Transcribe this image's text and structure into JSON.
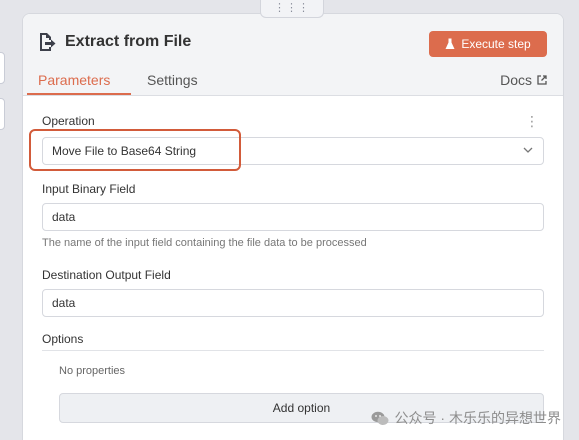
{
  "node": {
    "title": "Extract from File",
    "execute_label": "Execute step",
    "icon": "file-export-icon"
  },
  "tabs": {
    "parameters": "Parameters",
    "settings": "Settings",
    "docs": "Docs"
  },
  "fields": {
    "operation_label": "Operation",
    "operation_value": "Move File to Base64 String",
    "input_binary_label": "Input Binary Field",
    "input_binary_value": "data",
    "input_binary_hint": "The name of the input field containing the file data to be processed",
    "destination_label": "Destination Output Field",
    "destination_value": "data"
  },
  "options": {
    "label": "Options",
    "empty_text": "No properties",
    "add_label": "Add option"
  },
  "watermark": {
    "text": "公众号 · 木乐乐的异想世界"
  },
  "colors": {
    "accent": "#dc6c4d",
    "highlight_border": "#d25b3a"
  }
}
